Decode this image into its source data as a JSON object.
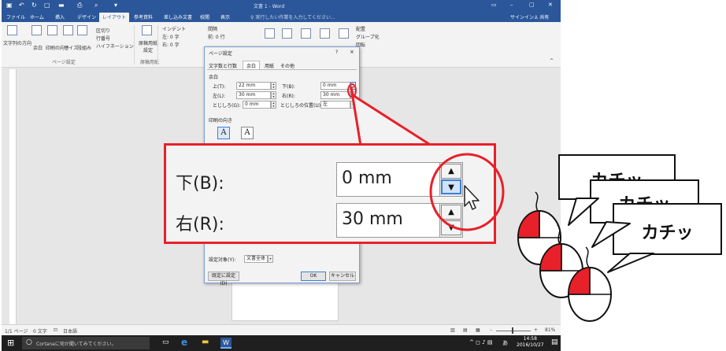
{
  "word": {
    "title": "文書 1 - Word",
    "tabs": [
      "ファイル",
      "ホーム",
      "挿入",
      "デザイン",
      "レイアウト",
      "参考資料",
      "差し込み文書",
      "校閲",
      "表示"
    ],
    "active_tab": "レイアウト",
    "tell_me": "実行したい作業を入力してください...",
    "signin": "サインイン",
    "share": "共有",
    "ribbon": {
      "text_direction": "文字列の方向",
      "margins": "余白",
      "orientation": "印刷の向き",
      "size": "サイズ",
      "columns": "段組み",
      "breaks": "区切り",
      "line_numbers": "行番号",
      "hyphenation": "ハイフネーション",
      "group_page_setup": "ページ設定",
      "manuscript": "原稿用紙設定",
      "group_manuscript": "原稿用紙",
      "indent": "インデント",
      "indent_left": "左: 0 字",
      "indent_right": "右: 0 字",
      "spacing": "間隔",
      "spacing_before": "前: 0 行",
      "arrange": "配置",
      "group": "グループ化",
      "rotate": "回転"
    },
    "status": {
      "page": "1/1 ページ",
      "words": "0 文字",
      "language": "日本語",
      "zoom": "81%"
    },
    "taskbar": {
      "cortana": "Cortanaに何か聞いてみてください。",
      "ime": "あ",
      "time": "14:58",
      "date": "2016/10/27"
    }
  },
  "dialog": {
    "title": "ページ設定",
    "help": "?",
    "close": "×",
    "tabs": [
      "文字数と行数",
      "余白",
      "用紙",
      "その他"
    ],
    "active_tab": "余白",
    "margins_heading": "余白",
    "top_label": "上(T):",
    "top_value": "22 mm",
    "bottom_label": "下(B):",
    "bottom_value": "0 mm",
    "left_label": "左(L):",
    "left_value": "30 mm",
    "right_label": "右(R):",
    "right_value": "30 mm",
    "gutter_label": "とじしろ(G):",
    "gutter_value": "0 mm",
    "gutter_pos_label": "とじしろの位置(U):",
    "gutter_pos_value": "左",
    "orientation_heading": "印刷の向き",
    "portrait_glyph": "A",
    "landscape_glyph": "A",
    "apply_label": "設定対象(Y):",
    "apply_value": "文書全体",
    "default_button": "既定に設定(D)",
    "ok_button": "OK",
    "cancel_button": "キャンセル"
  },
  "zoom": {
    "bottom_label": "下(B):",
    "bottom_value": "0 mm",
    "right_label": "右(R):",
    "right_value": "30 mm",
    "up_glyph": "▲",
    "down_glyph": "▼"
  },
  "bubbles": [
    "カチッ",
    "カチッ",
    "カチッ"
  ],
  "colors": {
    "word_blue": "#2b579a",
    "callout_red": "#e8202a",
    "mouse_red": "#e8202a"
  }
}
